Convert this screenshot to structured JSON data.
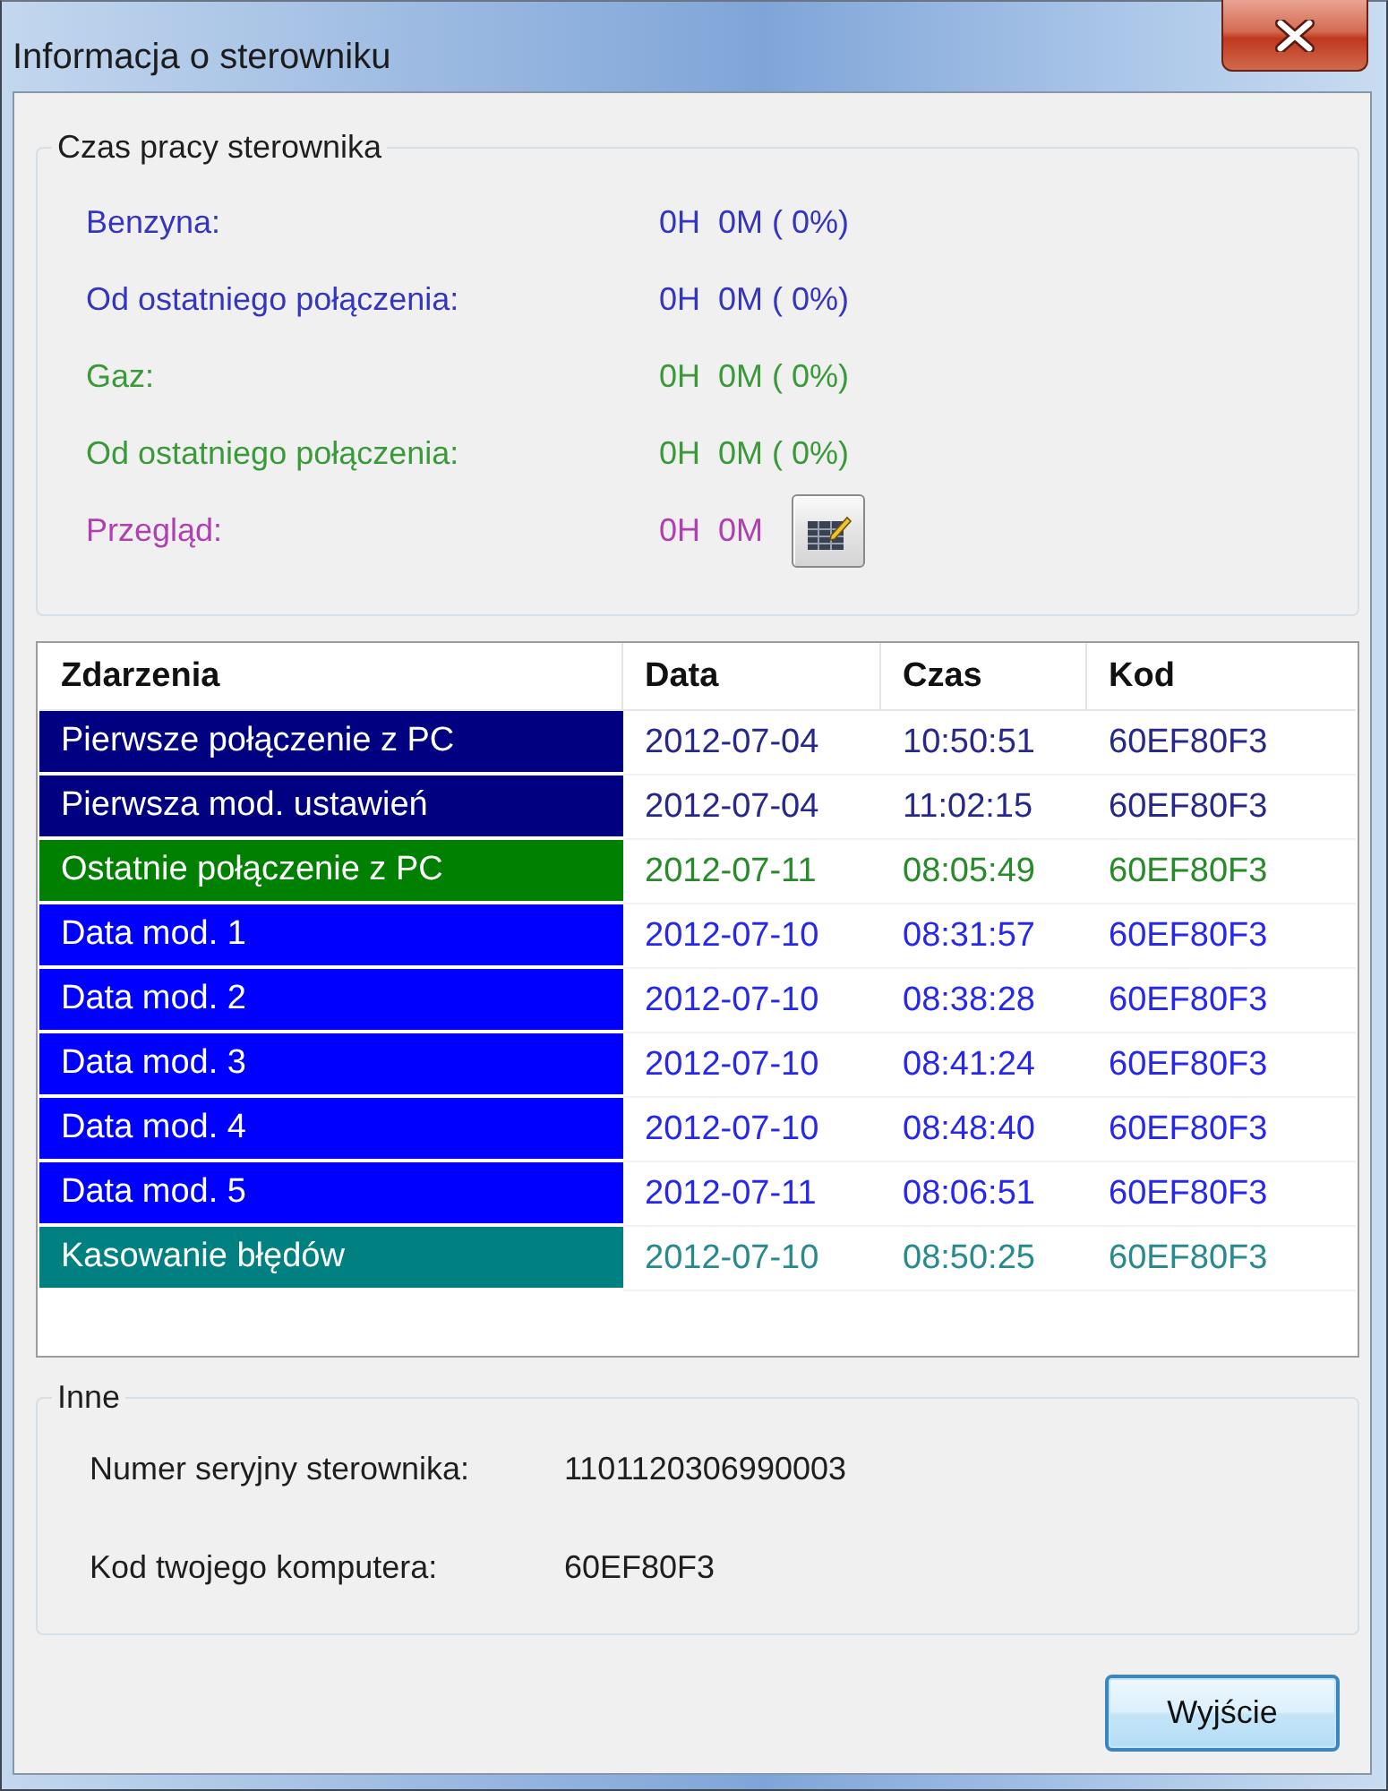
{
  "window": {
    "title": "Informacja o sterowniku"
  },
  "runtime": {
    "title": "Czas pracy sterownika",
    "rows": [
      {
        "label": "Benzyna:",
        "value": "0H  0M ( 0%)",
        "color": "#3535c0",
        "kind": "reading"
      },
      {
        "label": "Od ostatniego połączenia:",
        "value": "0H  0M ( 0%)",
        "color": "#3535c0",
        "kind": "reading"
      },
      {
        "label": "Gaz:",
        "value": "0H  0M ( 0%)",
        "color": "#3a9a3a",
        "kind": "reading"
      },
      {
        "label": "Od ostatniego połączenia:",
        "value": "0H  0M ( 0%)",
        "color": "#3a9a3a",
        "kind": "reading"
      },
      {
        "label": "Przegląd:",
        "value": "0H  0M",
        "color": "#b040b0",
        "kind": "reading_with_button"
      }
    ]
  },
  "table": {
    "columns": [
      "Zdarzenia",
      "Data",
      "Czas",
      "Kod"
    ],
    "rows": [
      {
        "event": "Pierwsze połączenie z PC",
        "date": "2012-07-04",
        "time": "10:50:51",
        "code": "60EF80F3",
        "color": "#000080"
      },
      {
        "event": "Pierwsza mod. ustawień",
        "date": "2012-07-04",
        "time": "11:02:15",
        "code": "60EF80F3",
        "color": "#000080"
      },
      {
        "event": "Ostatnie połączenie z PC",
        "date": "2012-07-11",
        "time": "08:05:49",
        "code": "60EF80F3",
        "color": "#008000"
      },
      {
        "event": "Data mod. 1",
        "date": "2012-07-10",
        "time": "08:31:57",
        "code": "60EF80F3",
        "color": "#0000ff"
      },
      {
        "event": "Data mod. 2",
        "date": "2012-07-10",
        "time": "08:38:28",
        "code": "60EF80F3",
        "color": "#0000ff"
      },
      {
        "event": "Data mod. 3",
        "date": "2012-07-10",
        "time": "08:41:24",
        "code": "60EF80F3",
        "color": "#0000ff"
      },
      {
        "event": "Data mod. 4",
        "date": "2012-07-10",
        "time": "08:48:40",
        "code": "60EF80F3",
        "color": "#0000ff"
      },
      {
        "event": "Data mod. 5",
        "date": "2012-07-11",
        "time": "08:06:51",
        "code": "60EF80F3",
        "color": "#0000ff"
      },
      {
        "event": "Kasowanie błędów",
        "date": "2012-07-10",
        "time": "08:50:25",
        "code": "60EF80F3",
        "color": "#008080"
      }
    ]
  },
  "other": {
    "title": "Inne",
    "rows": [
      {
        "label": "Numer seryjny sterownika:",
        "value": "1101120306990003"
      },
      {
        "label": "Kod twojego komputera:",
        "value": "60EF80F3"
      }
    ]
  },
  "buttons": [
    "Wyjście"
  ]
}
